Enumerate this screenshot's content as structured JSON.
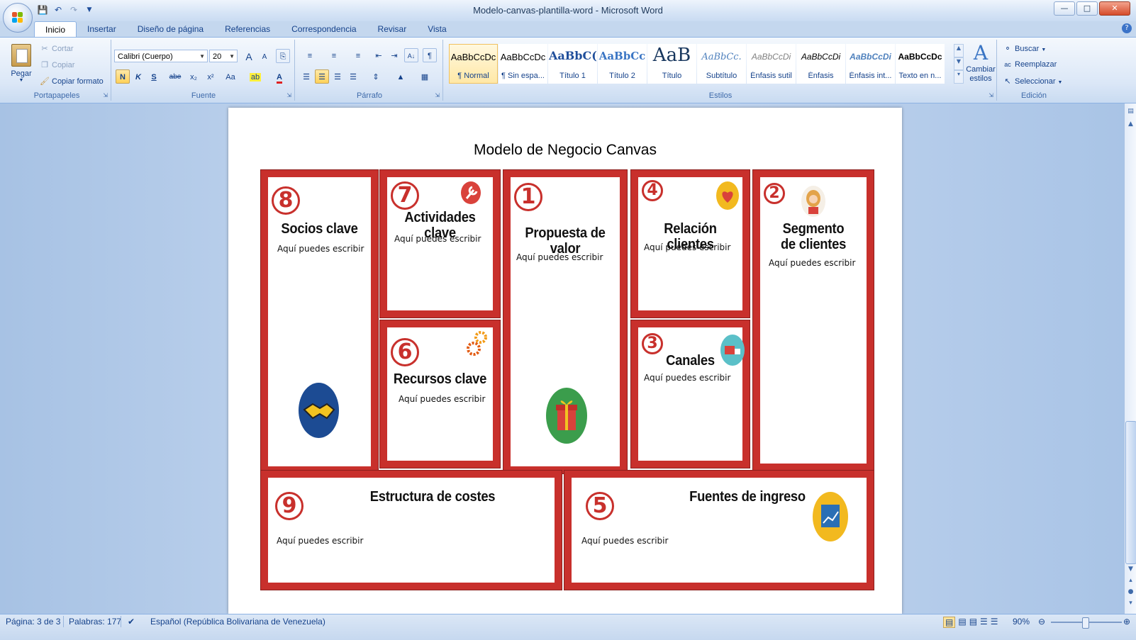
{
  "window": {
    "title": "Modelo-canvas-plantilla-word - Microsoft Word",
    "controls": [
      "—",
      "□",
      "✕"
    ]
  },
  "quick_access": [
    "save-icon",
    "undo-icon",
    "redo-icon",
    "customize-icon"
  ],
  "tabs": [
    "Inicio",
    "Insertar",
    "Diseño de página",
    "Referencias",
    "Correspondencia",
    "Revisar",
    "Vista"
  ],
  "ribbon": {
    "clipboard": {
      "label": "Portapapeles",
      "paste": "Pegar",
      "cut": "Cortar",
      "copy": "Copiar",
      "format_painter": "Copiar formato"
    },
    "font": {
      "label": "Fuente",
      "family": "Calibri (Cuerpo)",
      "size": "20",
      "bold": "N",
      "italic": "K",
      "underline": "S",
      "strike": "abe",
      "subscript": "x₂",
      "superscript": "x²",
      "case": "Aa",
      "grow": "A",
      "shrink": "A"
    },
    "paragraph": {
      "label": "Párrafo",
      "pilcrow": "¶",
      "sort": "A↓"
    },
    "styles": {
      "label": "Estilos",
      "items": [
        {
          "sample": "AaBbCcDc",
          "name": "¶ Normal"
        },
        {
          "sample": "AaBbCcDc",
          "name": "¶ Sin espa..."
        },
        {
          "sample": "AaBbC(",
          "name": "Título 1"
        },
        {
          "sample": "AaBbCc",
          "name": "Título 2"
        },
        {
          "sample": "AaB",
          "name": "Título"
        },
        {
          "sample": "AaBbCc.",
          "name": "Subtítulo"
        },
        {
          "sample": "AaBbCcDi",
          "name": "Énfasis sutil"
        },
        {
          "sample": "AaBbCcDi",
          "name": "Énfasis"
        },
        {
          "sample": "AaBbCcDi",
          "name": "Énfasis int..."
        },
        {
          "sample": "AaBbCcDc",
          "name": "Texto en n..."
        }
      ],
      "change": "Cambiar estilos"
    },
    "editing": {
      "label": "Edición",
      "find": "Buscar",
      "replace": "Reemplazar",
      "select": "Seleccionar"
    }
  },
  "document": {
    "title": "Modelo de Negocio Canvas",
    "placeholder": "Aquí puedes escribir",
    "accent_color": "#c8302c",
    "blocks": {
      "socios": {
        "number": "8",
        "title": "Socios clave"
      },
      "actividades": {
        "number": "7",
        "title": "Actividades clave"
      },
      "recursos": {
        "number": "6",
        "title": "Recursos clave"
      },
      "propuesta": {
        "number": "1",
        "title": "Propuesta de valor"
      },
      "relacion": {
        "number": "4",
        "title": "Relación clientes"
      },
      "canales": {
        "number": "3",
        "title": "Canales"
      },
      "segmento": {
        "number": "2",
        "title": "Segmento de clientes"
      },
      "costes": {
        "number": "9",
        "title": "Estructura de costes"
      },
      "ingresos": {
        "number": "5",
        "title": "Fuentes de ingreso"
      }
    }
  },
  "statusbar": {
    "page": "Página: 3 de 3",
    "words": "Palabras: 177",
    "language": "Español (República Bolivariana de Venezuela)",
    "zoom": "90%"
  }
}
